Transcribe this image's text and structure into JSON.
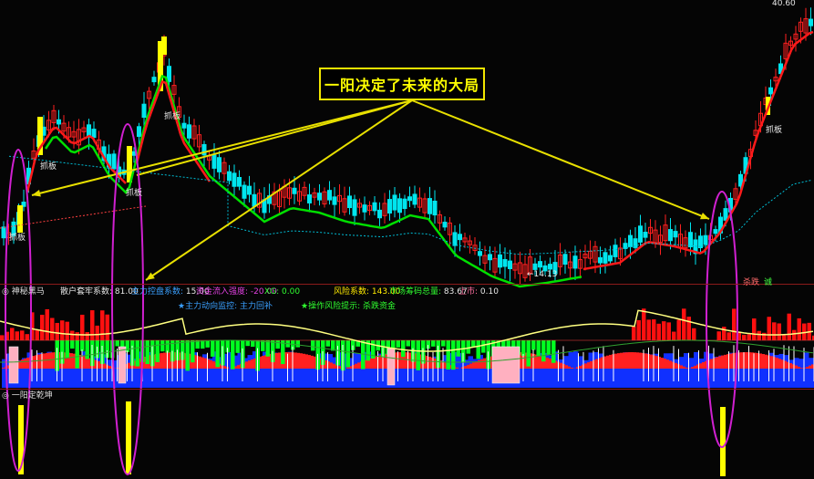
{
  "callout": "一阳决定了未来的大局",
  "price": {
    "high_label": "40.60",
    "low_label": "14.13",
    "tags": [
      "抓板",
      "抓板",
      "抓板",
      "抓板",
      "抓板"
    ]
  },
  "panel1": {
    "title": "神秘黑马",
    "params": [
      {
        "label": "散户套牢系数:",
        "value": "81.00"
      },
      {
        "label": "主力控盘系数:",
        "value": "15.00"
      },
      {
        "label": "资金流入强度:",
        "value": "-20.00"
      },
      {
        "label": "XG:",
        "value": "0.00"
      },
      {
        "label": "风险系数:",
        "value": "143.00"
      },
      {
        "label": "市场筹码总量:",
        "value": "83.67"
      },
      {
        "label": "上市:",
        "value": "0.10"
      }
    ],
    "line2": [
      {
        "label": "★主力动向监控:",
        "value": "主力回补"
      },
      {
        "label": "★操作风险提示:",
        "value": "杀跌资金"
      }
    ],
    "right_tags": [
      "杀跌",
      "诚"
    ]
  },
  "panel2": {
    "title": "一阳定乾坤"
  },
  "colors": {
    "up": "#ff2020",
    "down": "#00e5ee",
    "ma_green": "#00e000",
    "ma_red": "#ff1a1a",
    "highlight": "#ffff00",
    "ellipse": "#d020d0",
    "arrow": "#e8e000"
  },
  "chart_data": {
    "type": "candlestick",
    "price_range": [
      14.13,
      40.6
    ],
    "candles": [],
    "note": ""
  }
}
